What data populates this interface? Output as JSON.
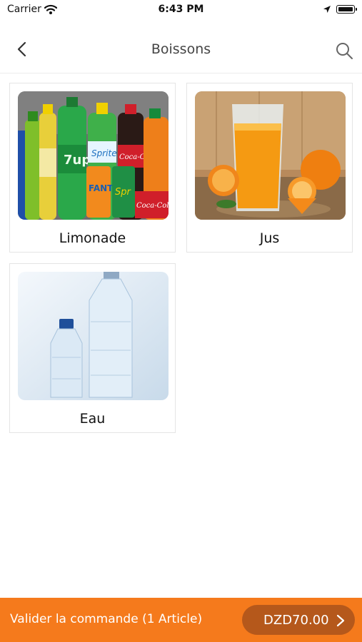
{
  "status_bar": {
    "carrier": "Carrier",
    "time": "6:43 PM"
  },
  "nav": {
    "title": "Boissons"
  },
  "categories": [
    {
      "label": "Limonade",
      "image": "soda-bottles-image"
    },
    {
      "label": "Jus",
      "image": "orange-juice-image"
    },
    {
      "label": "Eau",
      "image": "water-bottles-image"
    }
  ],
  "footer": {
    "validate_label": "Valider la commande (1 Article)",
    "price": "DZD70.00"
  },
  "colors": {
    "accent": "#f57a1c",
    "price_pill": "#b5581b"
  }
}
